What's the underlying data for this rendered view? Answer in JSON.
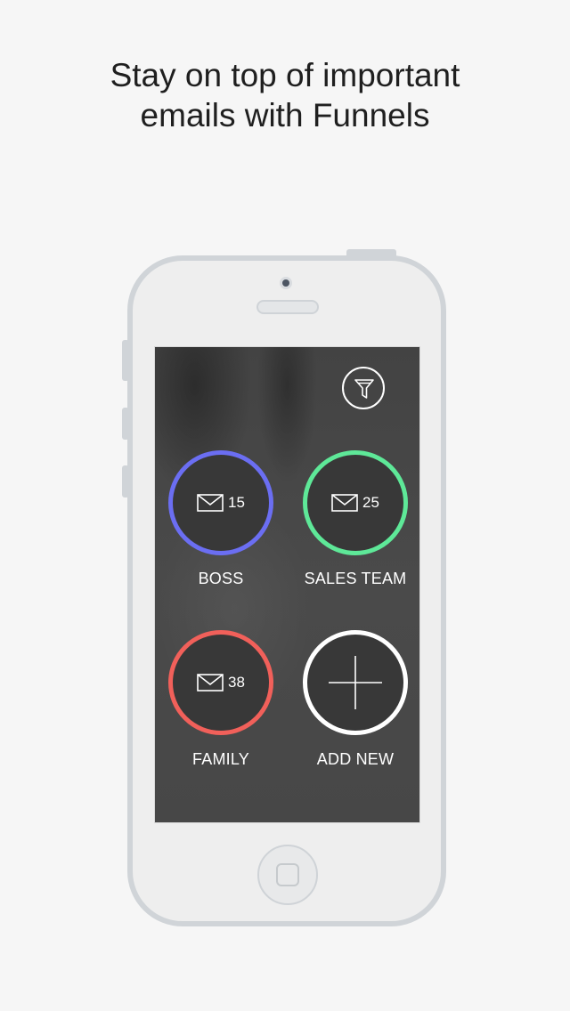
{
  "headline": {
    "line1": "Stay on top of important",
    "line2": "emails with Funnels"
  },
  "screen": {
    "filter_icon": "funnel-icon",
    "funnels": [
      {
        "label": "BOSS",
        "count": "15",
        "color": "#6b6ef2",
        "icon": "envelope-icon"
      },
      {
        "label": "SALES TEAM",
        "count": "25",
        "color": "#5ee898",
        "icon": "envelope-icon"
      },
      {
        "label": "FAMILY",
        "count": "38",
        "color": "#f1605a",
        "icon": "envelope-icon"
      }
    ],
    "add_new": {
      "label": "ADD NEW",
      "color": "#ffffff",
      "icon": "plus-icon"
    }
  }
}
